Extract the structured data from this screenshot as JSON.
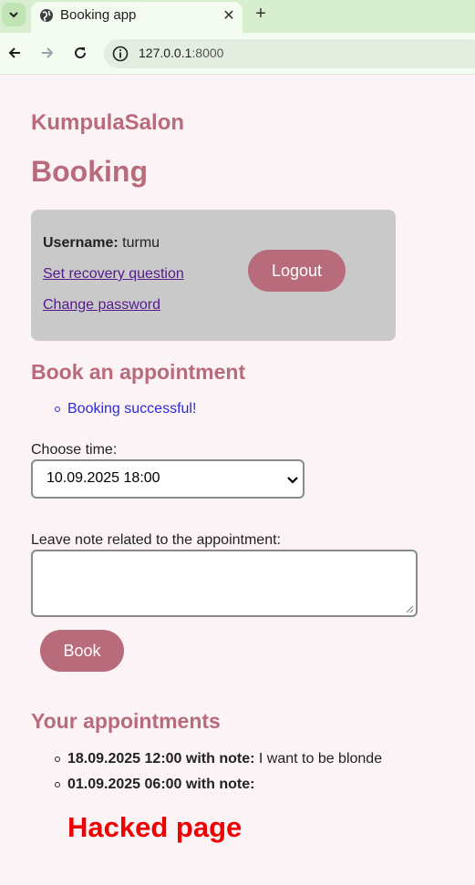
{
  "browser": {
    "tab_title": "Booking app",
    "url_host": "127.0.0.1",
    "url_port": ":8000"
  },
  "page": {
    "site_title": "KumpulaSalon",
    "heading": "Booking"
  },
  "user_panel": {
    "username_label": "Username:",
    "username_value": "turmu",
    "recovery_link": "Set recovery question",
    "change_password_link": "Change password",
    "logout_label": "Logout"
  },
  "booking_form": {
    "section_title": "Book an appointment",
    "messages": [
      "Booking successful!"
    ],
    "time_label": "Choose time:",
    "selected_time": "10.09.2025 18:00",
    "note_label": "Leave note related to the appointment:",
    "note_value": "",
    "book_label": "Book"
  },
  "appointments": {
    "section_title": "Your appointments",
    "items": [
      {
        "when": "18.09.2025 12:00 with note:",
        "note": "I want to be blonde"
      },
      {
        "when": "01.09.2025 06:00 with note:",
        "note": ""
      }
    ],
    "injected_text": "Hacked page"
  },
  "colors": {
    "accent": "#b86b7b",
    "panel_bg": "#c9c9c9",
    "page_bg": "#fcf3f6",
    "success": "#2b2bd6",
    "alert": "#ee0000"
  }
}
